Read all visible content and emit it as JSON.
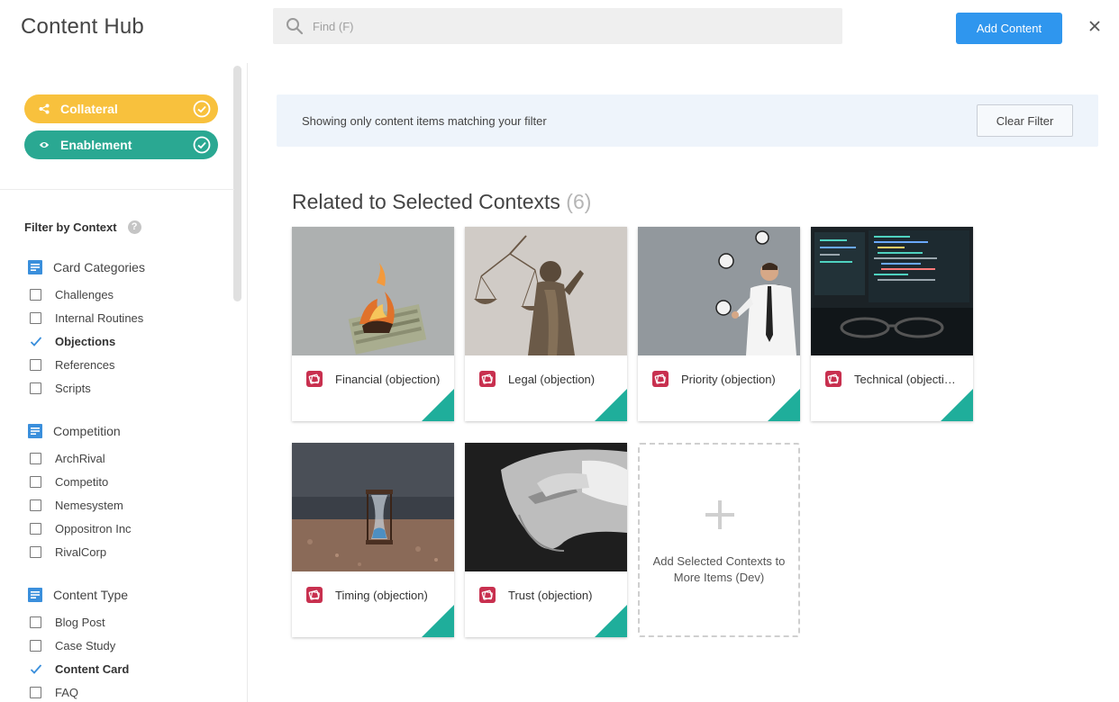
{
  "header": {
    "title": "Content Hub",
    "search_placeholder": "Find (F)",
    "add_label": "Add Content"
  },
  "sidebar": {
    "pills": [
      {
        "label": "Collateral",
        "color": "#f8c13d",
        "icon": "share-icon"
      },
      {
        "label": "Enablement",
        "color": "#2aa892",
        "icon": "eye-icon"
      }
    ],
    "filter_heading": "Filter by Context",
    "help": "?",
    "groups": [
      {
        "title": "Card Categories",
        "items": [
          {
            "label": "Challenges",
            "checked": false
          },
          {
            "label": "Internal Routines",
            "checked": false
          },
          {
            "label": "Objections",
            "checked": true
          },
          {
            "label": "References",
            "checked": false
          },
          {
            "label": "Scripts",
            "checked": false
          }
        ]
      },
      {
        "title": "Competition",
        "items": [
          {
            "label": "ArchRival",
            "checked": false
          },
          {
            "label": "Competito",
            "checked": false
          },
          {
            "label": "Nemesystem",
            "checked": false
          },
          {
            "label": "Oppositron Inc",
            "checked": false
          },
          {
            "label": "RivalCorp",
            "checked": false
          }
        ]
      },
      {
        "title": "Content Type",
        "items": [
          {
            "label": "Blog Post",
            "checked": false
          },
          {
            "label": "Case Study",
            "checked": false
          },
          {
            "label": "Content Card",
            "checked": true
          },
          {
            "label": "FAQ",
            "checked": false
          }
        ]
      }
    ]
  },
  "main": {
    "banner_text": "Showing only content items matching your filter",
    "clear_label": "Clear Filter",
    "section_title": "Related to Selected Contexts",
    "section_count": "(6)",
    "cards": [
      {
        "label": "Financial (objection)",
        "image": "burning-money-image"
      },
      {
        "label": "Legal (objection)",
        "image": "justice-statue-image"
      },
      {
        "label": "Priority (objection)",
        "image": "juggling-clocks-image"
      },
      {
        "label": "Technical (objection)",
        "image": "code-screens-image"
      },
      {
        "label": "Timing (objection)",
        "image": "hourglass-image"
      },
      {
        "label": "Trust (objection)",
        "image": "hands-image"
      }
    ],
    "add_card_text": "Add Selected Contexts to More Items (Dev)"
  },
  "colors": {
    "accent_blue": "#2f96ee",
    "teal": "#2aa892",
    "corner_teal": "#1fae9b",
    "card_icon": "#c8304f"
  }
}
